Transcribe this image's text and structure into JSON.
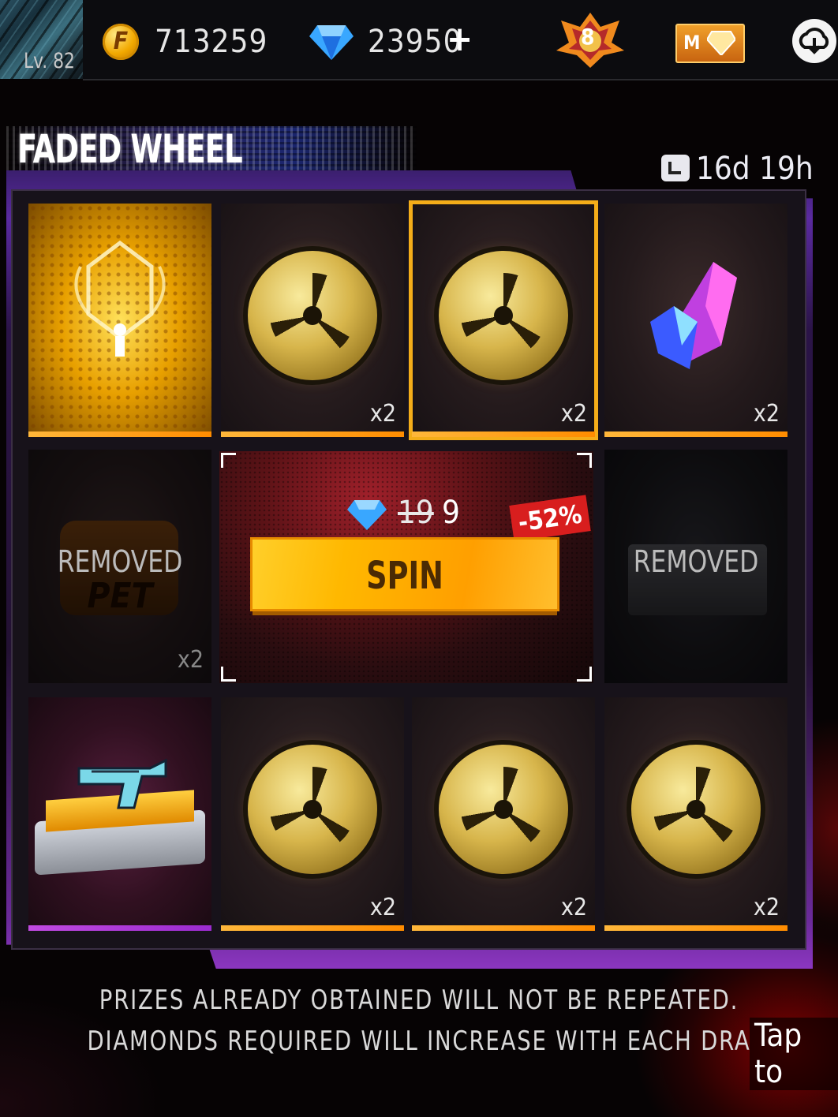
{
  "player": {
    "level": "Lv. 82"
  },
  "currency": {
    "coin_symbol": "F",
    "coins": "713259",
    "diamonds": "23950",
    "diamond_plus": "+"
  },
  "rank": {
    "tier": "8"
  },
  "membership": {
    "label": "M"
  },
  "event": {
    "title": "FADED WHEEL",
    "time_left": "16d 19h"
  },
  "prizes": [
    {
      "id": "p1",
      "item": "golden-emote-card",
      "qty": "",
      "status": "available",
      "bar": "orange"
    },
    {
      "id": "p2",
      "item": "gold-token",
      "qty": "x2",
      "status": "available",
      "bar": "orange"
    },
    {
      "id": "p3",
      "item": "gold-token",
      "qty": "x2",
      "status": "selected",
      "bar": "orange"
    },
    {
      "id": "p4",
      "item": "crystal-shards",
      "qty": "x2",
      "status": "available",
      "bar": "orange"
    },
    {
      "id": "p5",
      "item": "pet-food",
      "qty": "x2",
      "status": "removed",
      "overlay_text": "REMOVED",
      "item_text": "PET"
    },
    {
      "id": "p6",
      "item": "weapon-crate",
      "qty": "",
      "status": "removed",
      "overlay_text": "REMOVED"
    },
    {
      "id": "p7",
      "item": "gun-skin-crate",
      "qty": "",
      "status": "available",
      "bar": "purple"
    },
    {
      "id": "p8",
      "item": "gold-token",
      "qty": "x2",
      "status": "available",
      "bar": "orange"
    },
    {
      "id": "p9",
      "item": "gold-token",
      "qty": "x2",
      "status": "available",
      "bar": "orange"
    },
    {
      "id": "p10",
      "item": "gold-token",
      "qty": "x2",
      "status": "available",
      "bar": "orange"
    }
  ],
  "spin": {
    "label": "SPIN",
    "old_price": "19",
    "price": "9",
    "discount": "-52%"
  },
  "notes": {
    "line1": "PRIZES ALREADY OBTAINED WILL NOT BE REPEATED.",
    "line2": "DIAMONDS REQUIRED WILL INCREASE WITH EACH DRA"
  },
  "overlay": {
    "tap": "Tap to"
  },
  "colors": {
    "accent_gold": "#f4ad19",
    "bar_orange": "#ff9a10",
    "bar_purple": "#b03cd8",
    "discount_red": "#d81e1e",
    "frame_purple": "#6b2a9a"
  }
}
